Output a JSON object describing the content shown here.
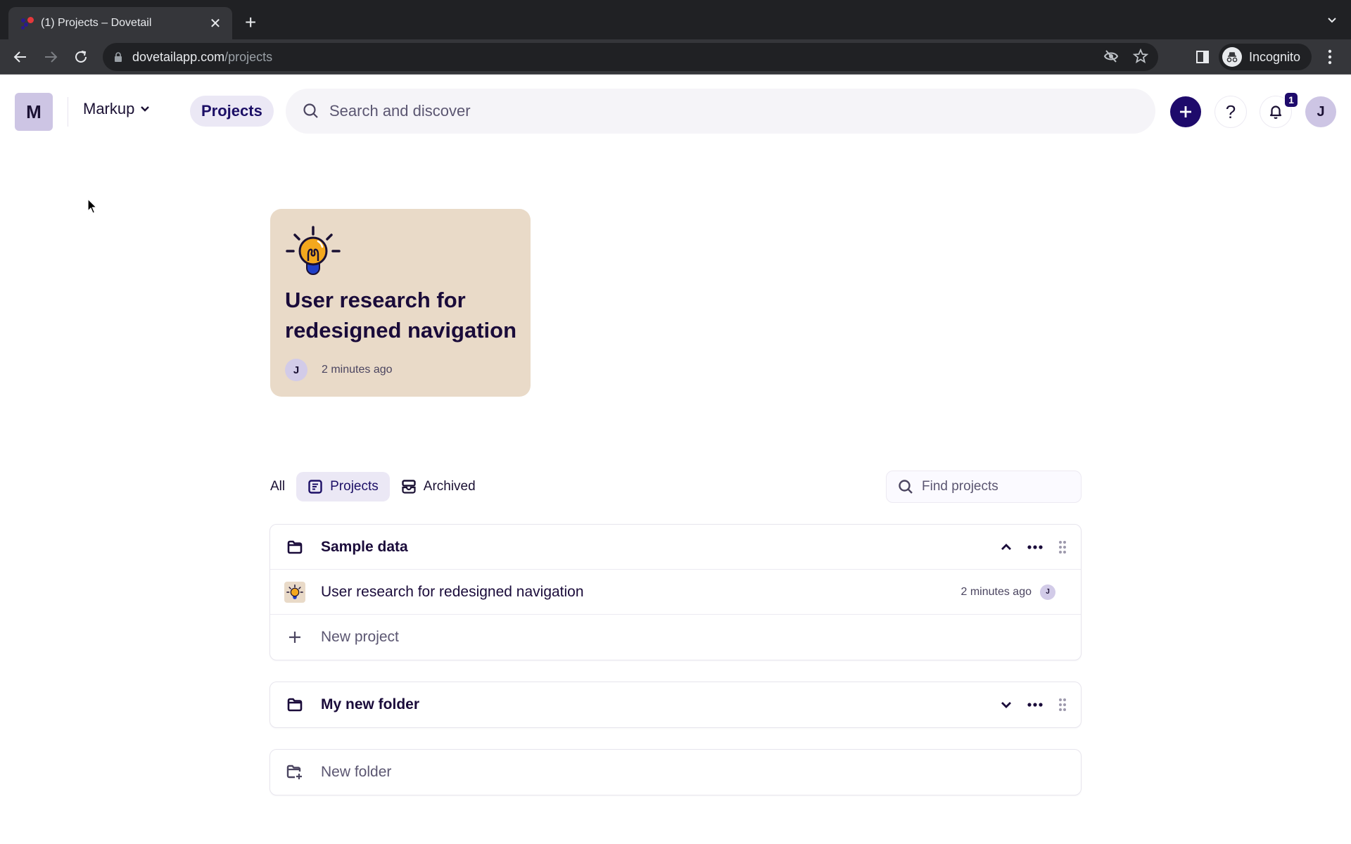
{
  "browser": {
    "tab_title": "(1) Projects – Dovetail",
    "url_host": "dovetailapp.com",
    "url_path": "/projects",
    "profile_label": "Incognito"
  },
  "header": {
    "workspace_initial": "M",
    "workspace_name": "Markup",
    "nav_projects": "Projects",
    "search_placeholder": "Search and discover",
    "help_label": "?",
    "notification_count": "1",
    "user_initial": "J"
  },
  "featured": {
    "title": "User research for redesigned navigation",
    "avatar_initial": "J",
    "time": "2 minutes ago",
    "icon": "lightbulb-icon",
    "bg_color": "#e9dac8"
  },
  "filters": {
    "tabs": [
      {
        "label": "All",
        "active": false
      },
      {
        "label": "Projects",
        "active": true,
        "icon": "project-doc-icon"
      },
      {
        "label": "Archived",
        "active": false,
        "icon": "archive-icon"
      }
    ],
    "find_placeholder": "Find projects"
  },
  "folders": [
    {
      "name": "Sample data",
      "expanded": true,
      "projects": [
        {
          "name": "User research for redesigned navigation",
          "time": "2 minutes ago",
          "owner_initial": "J"
        }
      ],
      "new_project_label": "New project"
    },
    {
      "name": "My new folder",
      "expanded": false
    }
  ],
  "new_folder_label": "New folder",
  "colors": {
    "brand_dark": "#1e0a6b",
    "accent_soft": "#ebe8f5",
    "avatar": "#cdc5e4"
  }
}
